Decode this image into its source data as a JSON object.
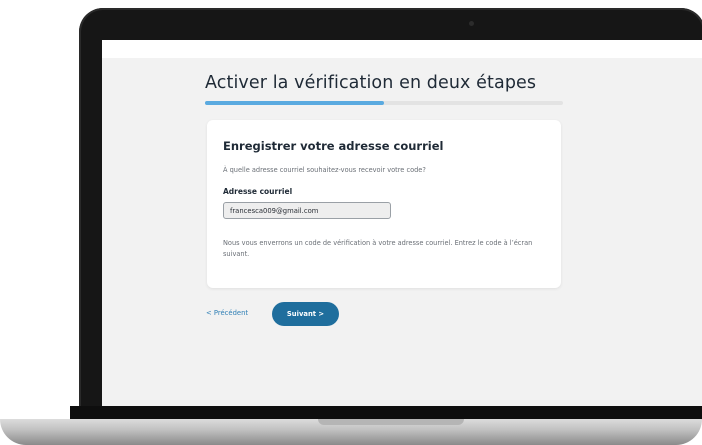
{
  "page": {
    "title": "Activer la vérification en deux étapes",
    "progress": 0.5
  },
  "card": {
    "title": "Enregistrer votre adresse courriel",
    "question": "À quelle adresse courriel souhaitez-vous recevoir votre code?",
    "field_label": "Adresse courriel",
    "email_value": "francesca009@gmail.com",
    "note": "Nous vous enverrons un code de vérification à votre adresse courriel. Entrez le code à l’écran suivant."
  },
  "nav": {
    "previous_label": "< Précédent",
    "next_label": "Suivant >"
  },
  "colors": {
    "accent": "#1f6e9d",
    "progress": "#5aaae0",
    "link": "#2f7fb5"
  }
}
